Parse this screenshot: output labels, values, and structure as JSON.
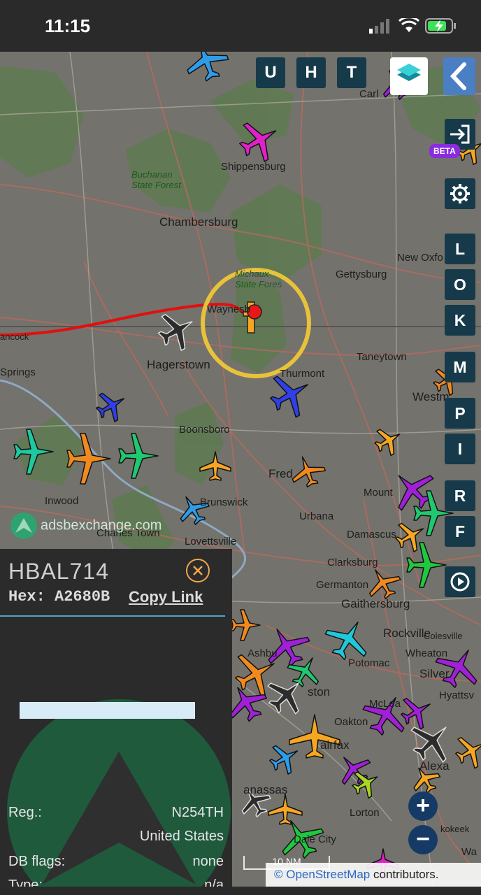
{
  "status_bar": {
    "time": "11:15"
  },
  "toolbar": {
    "buttons": [
      "U",
      "H",
      "T"
    ],
    "beta_label": "BETA"
  },
  "side_buttons": [
    "L",
    "O",
    "K",
    "M",
    "P",
    "I",
    "R",
    "F"
  ],
  "map": {
    "places": {
      "shippensburg": "Shippensburg",
      "buchanan": "Buchanan\nState Forest",
      "chambersburg": "Chambersburg",
      "new_oxford": "New Oxfo",
      "gettysburg": "Gettysburg",
      "michaux": "Michaux\nState Fores",
      "waynesboro": "Waynesb",
      "hancock": "ancock",
      "hagerstown": "Hagerstown",
      "springs": "Springs",
      "taneytown": "Taneytown",
      "thurmont": "Thurmont",
      "westminster": "Westm",
      "boonsboro": "Boonsboro",
      "frederick": "Fred",
      "mount": "Mount",
      "inwood": "Inwood",
      "charles_town": "Charles Town",
      "brunswick": "Brunswick",
      "lovettsville": "Lovettsville",
      "urbana": "Urbana",
      "damascus": "Damascus",
      "clarksburg": "Clarksburg",
      "germantown": "Germanton",
      "gaithersburg": "Gaithersburg",
      "rockville": "Rockville",
      "colesville": "Colesville",
      "wheaton": "Wheaton",
      "silver": "Silver",
      "hyattsv": "Hyattsv",
      "potomac": "Potomac",
      "ashburn": "Ashbu",
      "reston": "ston",
      "oakton": "Oakton",
      "fairfax": "airfax",
      "mclean": "McLea",
      "alexandria": "Alexa",
      "manassas": "anassas",
      "lorton": "Lorton",
      "dale_city": "Dale City",
      "carlisle": "Carl",
      "kokeek": "kokeek",
      "woodbridge": "Wa"
    },
    "attribution_osm": "© OpenStreetMap",
    "attribution_rest": " contributors.",
    "watermark": "adsbexchange.com",
    "scale": "10 NM",
    "colors": {
      "track": "#e01010",
      "selection_ring": "#e8c23a"
    }
  },
  "panel": {
    "callsign": "HBAL714",
    "hex_label": "Hex:",
    "hex": "A2680B",
    "copy_link": "Copy Link",
    "rows": [
      {
        "key": "Reg.:",
        "value": "N254TH"
      },
      {
        "key": "",
        "value": "United States"
      },
      {
        "key": "DB flags:",
        "value": "none"
      },
      {
        "key": "Type:",
        "value": "n/a"
      }
    ]
  }
}
